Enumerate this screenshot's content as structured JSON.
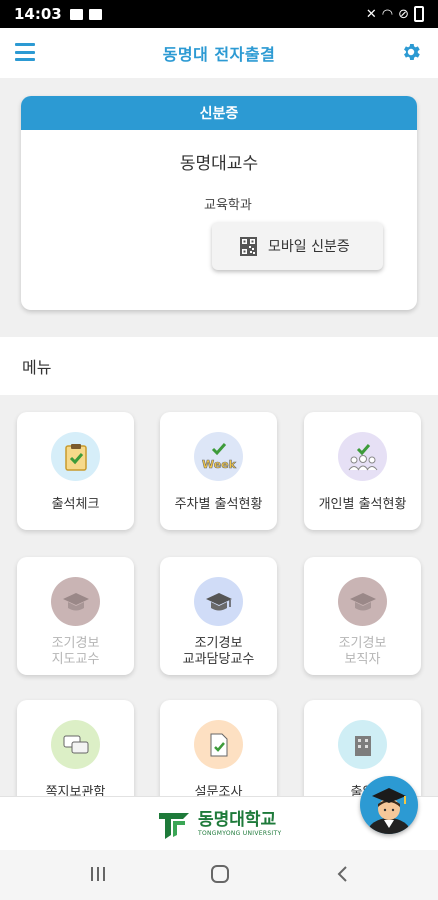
{
  "status": {
    "time": "14:03"
  },
  "appbar": {
    "title": "동명대 전자출결"
  },
  "id_card": {
    "header": "신분증",
    "name": "동명대교수",
    "department": "교육학과",
    "mobile_button": "모바일 신분증"
  },
  "menu": {
    "header": "메뉴",
    "tiles": [
      {
        "label": "출석체크",
        "icon": "clipboard-check-icon",
        "color": "#d6eef9",
        "enabled": true
      },
      {
        "label": "주차별 출석현황",
        "icon": "week-check-icon",
        "color": "#dde6f7",
        "enabled": true
      },
      {
        "label": "개인별 출석현황",
        "icon": "people-check-icon",
        "color": "#e6e0f5",
        "enabled": true
      },
      {
        "label": "조기경보\n지도교수",
        "icon": "graduation-cap-icon",
        "color": "#c9b4b4",
        "enabled": false
      },
      {
        "label": "조기경보\n교과담당교수",
        "icon": "graduation-cap-icon",
        "color": "#d0dcf7",
        "enabled": true
      },
      {
        "label": "조기경보\n보직자",
        "icon": "graduation-cap-icon",
        "color": "#c9b4b4",
        "enabled": false
      },
      {
        "label": "쪽지보관함",
        "icon": "chat-bubbles-icon",
        "color": "#dcefc6",
        "enabled": true
      },
      {
        "label": "설문조사",
        "icon": "survey-icon",
        "color": "#fde0c2",
        "enabled": true
      },
      {
        "label": "출입",
        "icon": "building-icon",
        "color": "#cfeef5",
        "enabled": true
      }
    ]
  },
  "footer": {
    "logo_korean": "동명대학교",
    "logo_english": "TONGMYONG UNIVERSITY"
  }
}
